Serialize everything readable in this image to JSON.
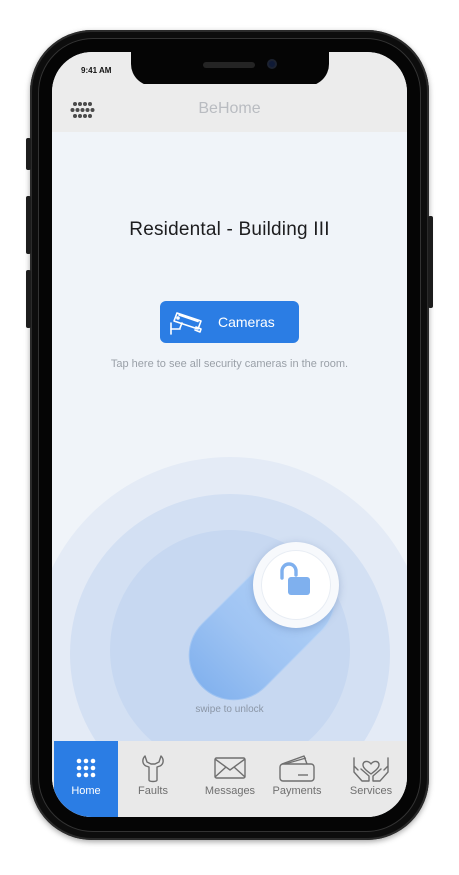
{
  "status_bar": {
    "time": "9:41 AM"
  },
  "header": {
    "app_title": "BeHome",
    "menu_icon": "grid-menu-icon"
  },
  "main": {
    "building_title": "Residental - Building III",
    "cameras_button": {
      "label": "Cameras",
      "icon": "cctv-camera-icon"
    },
    "cameras_hint": "Tap here to see all security cameras in the room.",
    "unlock": {
      "label": "swipe to unlock",
      "icon": "unlocked-padlock-icon"
    }
  },
  "tab_bar": {
    "active": "Home",
    "items": [
      {
        "label": "Home",
        "icon": "grid-dots-icon"
      },
      {
        "label": "Faults",
        "icon": "wrench-icon"
      },
      {
        "label": "Messages",
        "icon": "envelope-icon"
      },
      {
        "label": "Payments",
        "icon": "wallet-icon"
      },
      {
        "label": "Services",
        "icon": "hands-heart-icon"
      }
    ]
  },
  "colors": {
    "accent": "#2b7de4",
    "background": "#f0f4f9",
    "bar": "#ececec",
    "title_text": "#1d1d1f",
    "hint_text": "#9aa0a8"
  }
}
